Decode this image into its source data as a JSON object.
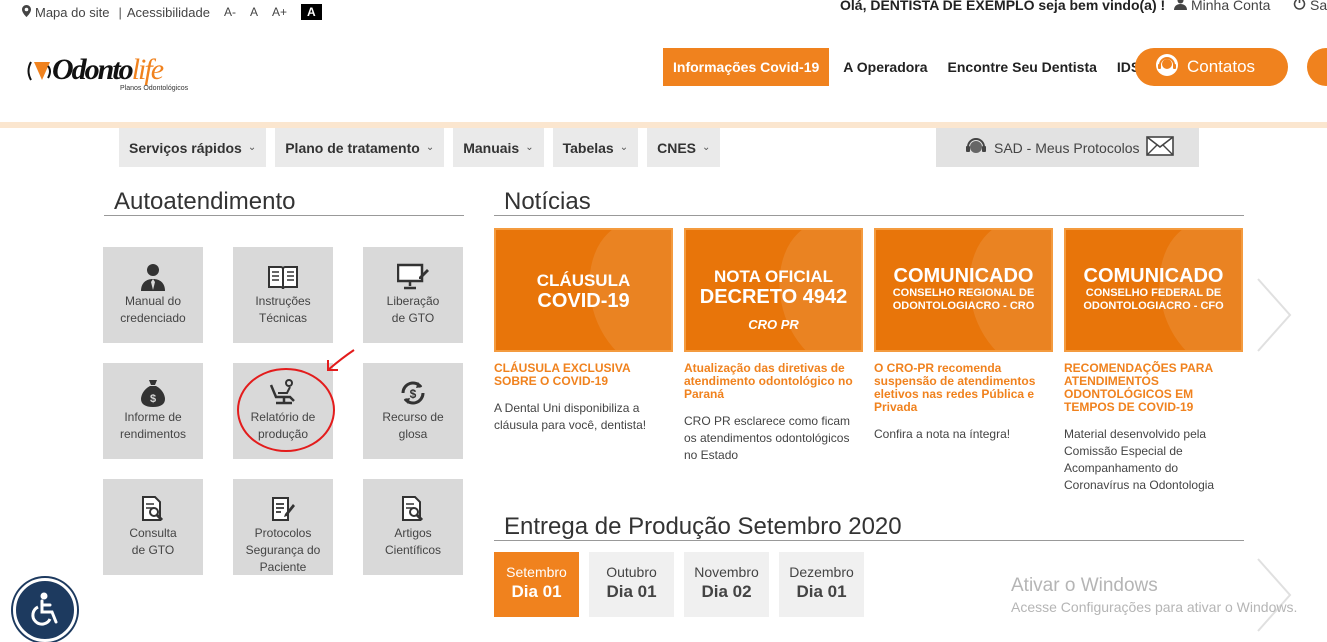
{
  "topbar": {
    "sitemap": "Mapa do site",
    "accessibility": "Acessibilidade",
    "font_decrease": "A-",
    "font_normal": "A",
    "font_increase": "A+",
    "contrast": "A",
    "welcome": "Olá, DENTISTA DE EXEMPLO seja bem vindo(a) !",
    "my_account": "Minha Conta",
    "logout": "Sair"
  },
  "logo": {
    "word_a": "Odonto",
    "word_b": "life",
    "tagline": "Planos Odontológicos"
  },
  "nav": {
    "covid": "Informações Covid-19",
    "operator": "A Operadora",
    "find_dentist": "Encontre Seu Dentista",
    "idss": "IDSS",
    "contacts": "Contatos"
  },
  "menu": {
    "items": [
      "Serviços rápidos",
      "Plano de tratamento",
      "Manuais",
      "Tabelas",
      "CNES"
    ],
    "sad": "SAD - Meus Protocolos"
  },
  "self_service": {
    "title": "Autoatendimento",
    "tiles": [
      {
        "line1": "Manual do",
        "line2": "credenciado",
        "line3": "",
        "icon": "user-tie-icon"
      },
      {
        "line1": "Instruções",
        "line2": "Técnicas",
        "line3": "",
        "icon": "book-icon"
      },
      {
        "line1": "Liberação",
        "line2": "de GTO",
        "line3": "",
        "icon": "monitor-edit-icon"
      },
      {
        "line1": "Informe de",
        "line2": "rendimentos",
        "line3": "",
        "icon": "money-bag-icon"
      },
      {
        "line1": "Relatório de",
        "line2": "produção",
        "line3": "",
        "icon": "dental-chair-icon"
      },
      {
        "line1": "Recurso de",
        "line2": "glosa",
        "line3": "",
        "icon": "dollar-refresh-icon"
      },
      {
        "line1": "Consulta",
        "line2": "de GTO",
        "line3": "",
        "icon": "document-search-icon"
      },
      {
        "line1": "Protocolos",
        "line2": "Segurança do",
        "line3": "Paciente",
        "icon": "checklist-icon"
      },
      {
        "line1": "Artigos",
        "line2": "Científicos",
        "line3": "",
        "icon": "article-search-icon"
      }
    ]
  },
  "news": {
    "title": "Notícias",
    "items": [
      {
        "card_l1": "CLÁUSULA",
        "card_l2": "COVID-19",
        "card_l3": "",
        "headline": "CLÁUSULA EXCLUSIVA SOBRE O COVID-19",
        "body": "A Dental Uni disponibiliza a cláusula para você, dentista!"
      },
      {
        "card_l1": "NOTA OFICIAL",
        "card_l2": "DECRETO 4942",
        "card_l3": "CRO PR",
        "headline": "Atualização das diretivas de atendimento odontológico no Paraná",
        "body": "CRO PR esclarece como ficam os atendimentos odontológicos no Estado"
      },
      {
        "card_l1": "COMUNICADO",
        "card_l2": "CONSELHO REGIONAL DE",
        "card_l3": "ODONTOLOGIACRO - CRO",
        "headline": "O CRO-PR recomenda suspensão de atendimentos eletivos nas redes Pública e Privada",
        "body": "Confira a nota na íntegra!"
      },
      {
        "card_l1": "COMUNICADO",
        "card_l2": "CONSELHO FEDERAL DE",
        "card_l3": "ODONTOLOGIACRO - CFO",
        "headline": "RECOMENDAÇÕES PARA ATENDIMENTOS ODONTOLÓGICOS EM TEMPOS DE COVID-19",
        "body": "Material desenvolvido pela Comissão Especial de Acompanhamento do Coronavírus na Odontologia"
      }
    ]
  },
  "production": {
    "title": "Entrega de Produção Setembro 2020",
    "items": [
      {
        "month": "Setembro",
        "day": "Dia 01",
        "active": true
      },
      {
        "month": "Outubro",
        "day": "Dia 01",
        "active": false
      },
      {
        "month": "Novembro",
        "day": "Dia 02",
        "active": false
      },
      {
        "month": "Dezembro",
        "day": "Dia 01",
        "active": false
      }
    ]
  },
  "watermark": {
    "line1": "Ativar o Windows",
    "line2": "Acesse Configurações para ativar o Windows."
  },
  "colors": {
    "brand_orange": "#f0821e",
    "card_orange": "#e8750a",
    "annotation_red": "#e31c1c"
  }
}
